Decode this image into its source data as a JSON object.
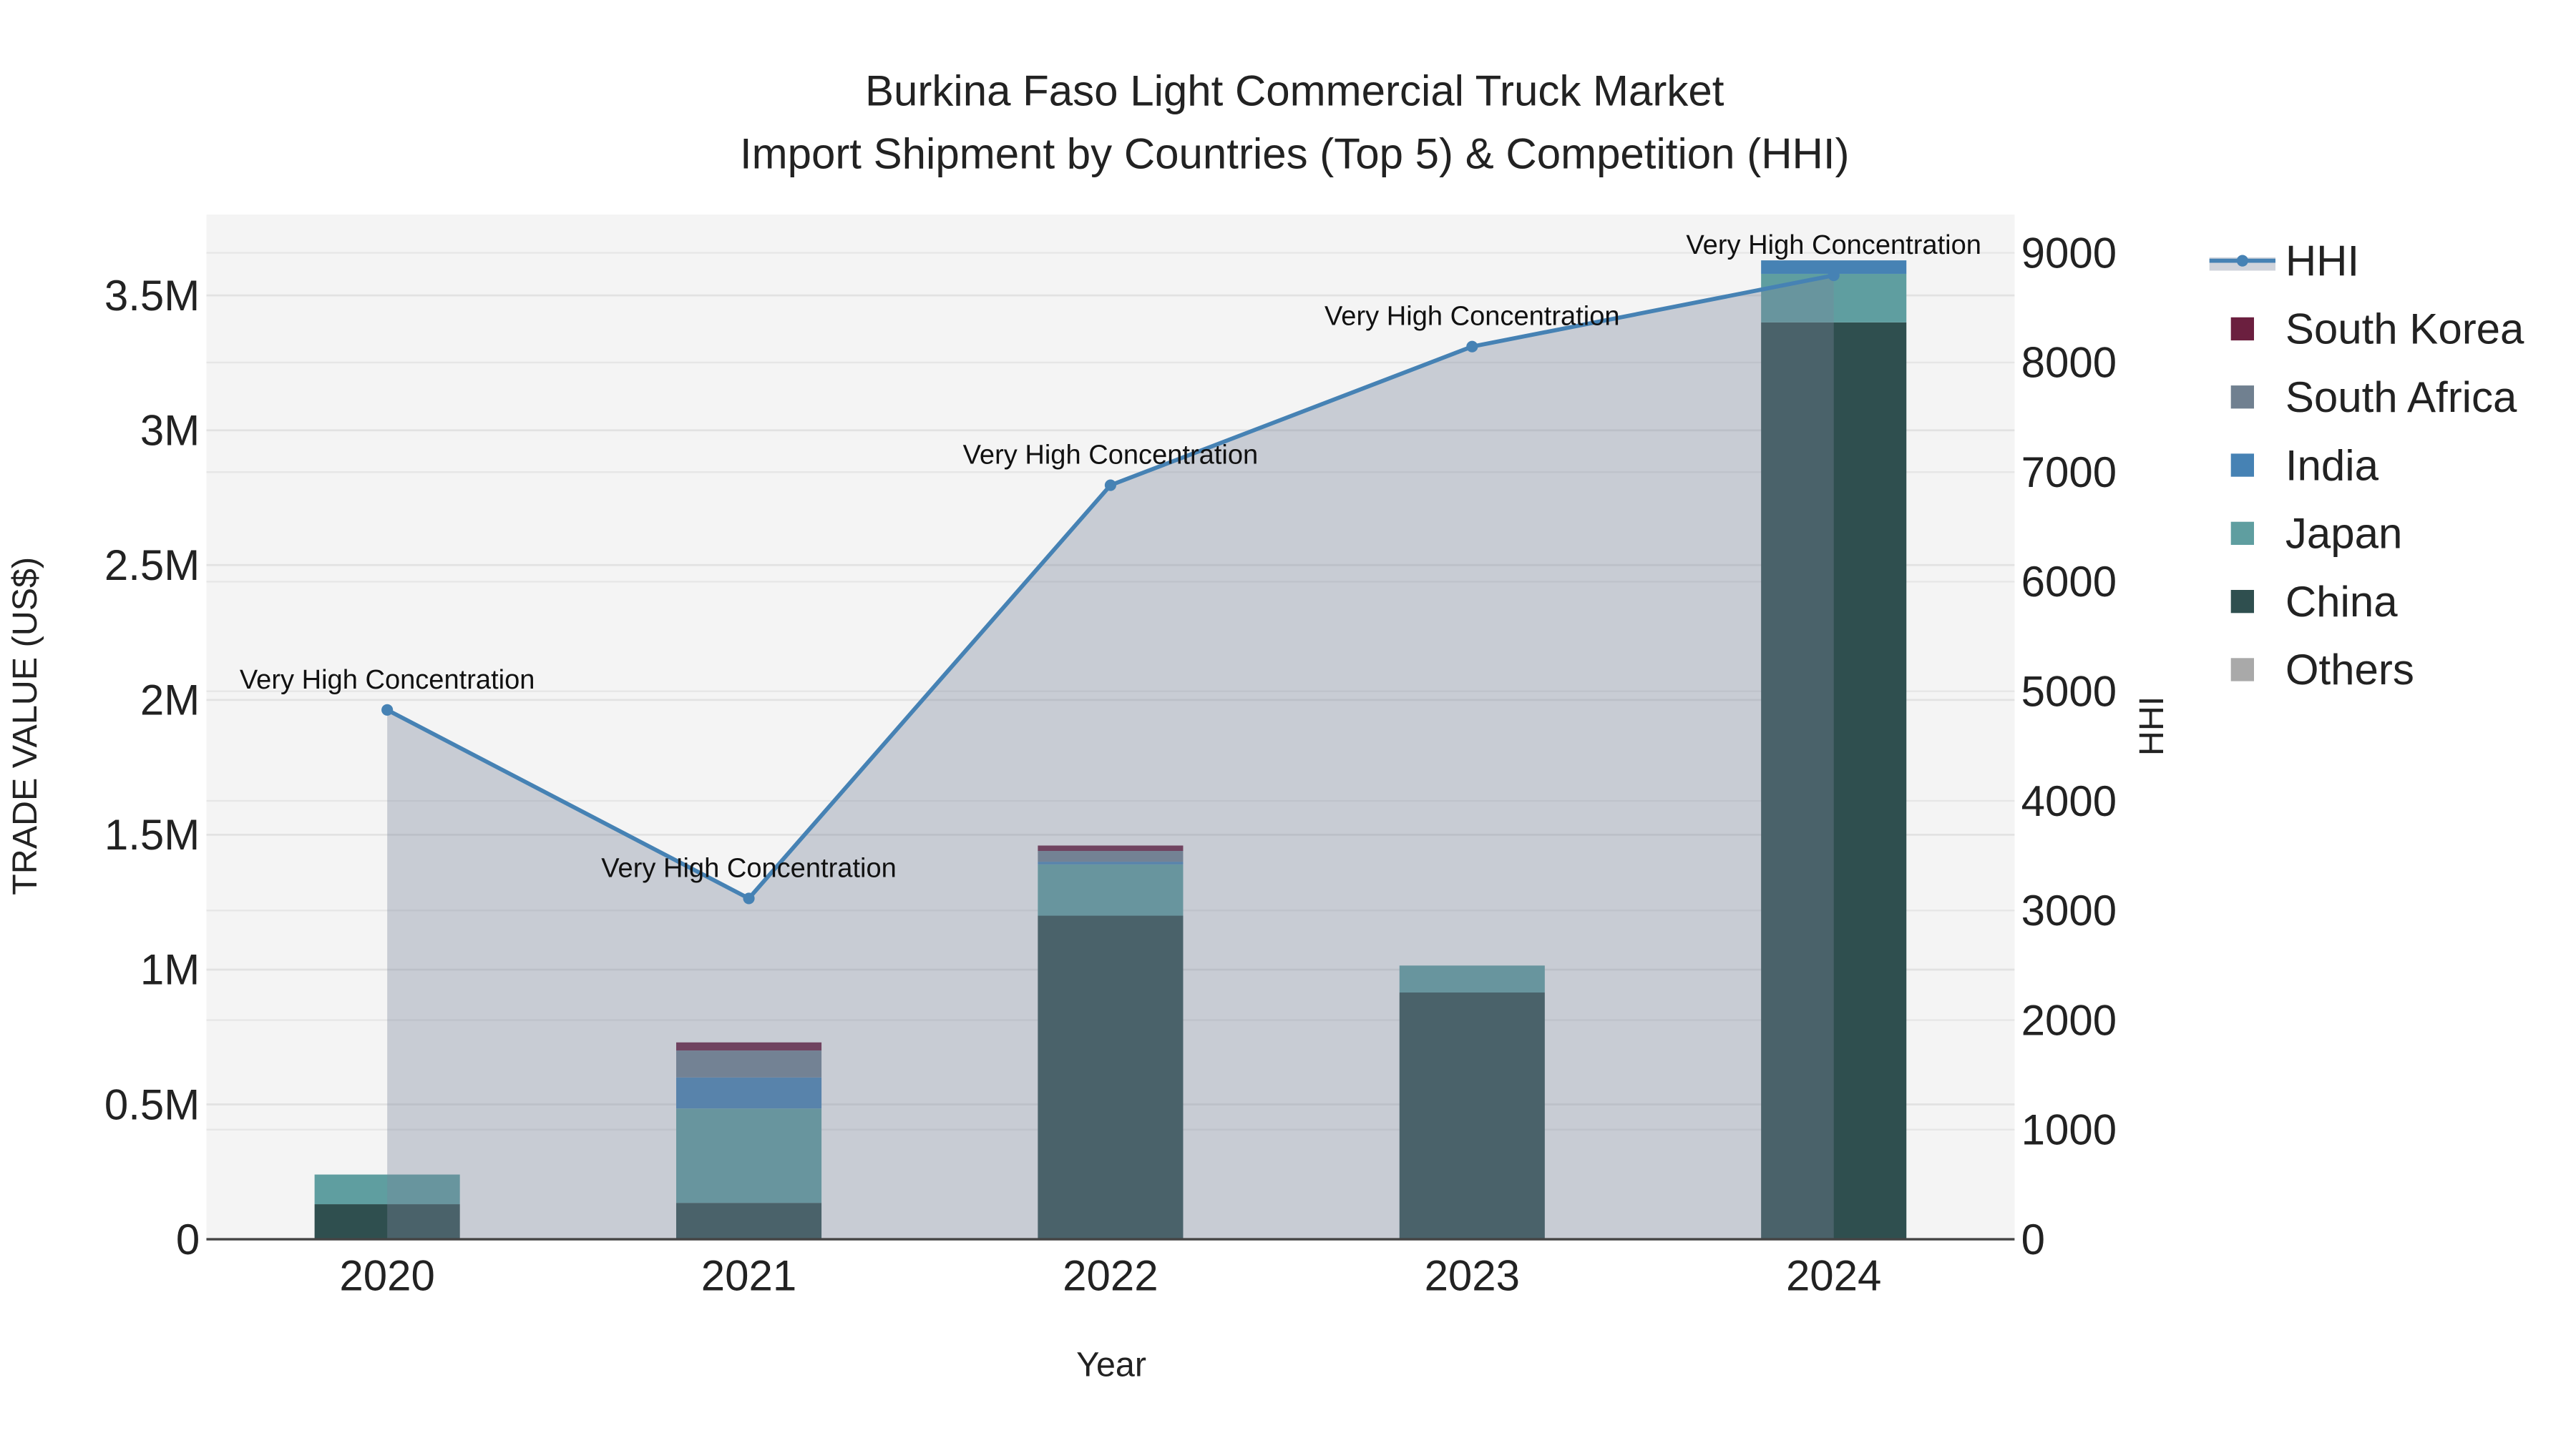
{
  "chart_data": {
    "type": "bar",
    "title_line1": "Burkina Faso Light Commercial Truck Market",
    "title_line2": "Import Shipment by Countries (Top 5) & Competition (HHI)",
    "xlabel": "Year",
    "ylabel": "TRADE VALUE (US$)",
    "y2label": "HHI",
    "categories": [
      "2020",
      "2021",
      "2022",
      "2023",
      "2024"
    ],
    "ylim": [
      0,
      3800000
    ],
    "y_ticks": [
      0,
      500000,
      1000000,
      1500000,
      2000000,
      2500000,
      3000000,
      3500000
    ],
    "y_tick_labels": [
      "0",
      "0.5M",
      "1M",
      "1.5M",
      "2M",
      "2.5M",
      "3M",
      "3.5M"
    ],
    "y2lim": [
      0,
      9350
    ],
    "y2_ticks": [
      0,
      1000,
      2000,
      3000,
      4000,
      5000,
      6000,
      7000,
      8000,
      9000
    ],
    "y2_tick_labels": [
      "0",
      "1000",
      "2000",
      "3000",
      "4000",
      "5000",
      "6000",
      "7000",
      "8000",
      "9000"
    ],
    "series": [
      {
        "name": "China",
        "color": "#2f4f4f",
        "values": [
          130000,
          135000,
          1200000,
          915000,
          3400000
        ]
      },
      {
        "name": "Japan",
        "color": "#5f9ea0",
        "values": [
          110000,
          350000,
          190000,
          100000,
          180000
        ]
      },
      {
        "name": "India",
        "color": "#4682b4",
        "values": [
          0,
          115000,
          10000,
          0,
          50000
        ]
      },
      {
        "name": "South Africa",
        "color": "#708090",
        "values": [
          0,
          100000,
          40000,
          0,
          0
        ]
      },
      {
        "name": "South Korea",
        "color": "#6b1f3f",
        "values": [
          0,
          30000,
          20000,
          0,
          0
        ]
      },
      {
        "name": "Others",
        "color": "#a9a9a9",
        "values": [
          0,
          0,
          0,
          0,
          0
        ]
      }
    ],
    "hhi": {
      "name": "HHI",
      "color": "#4682b4",
      "values": [
        4830,
        3110,
        6880,
        8145,
        8795
      ],
      "annotations": [
        "Very High Concentration",
        "Very High Concentration",
        "Very High Concentration",
        "Very High Concentration",
        "Very High Concentration"
      ]
    },
    "legend_order": [
      "HHI",
      "South Korea",
      "South Africa",
      "India",
      "Japan",
      "China",
      "Others"
    ],
    "legend_placement": "right",
    "grid": true
  }
}
